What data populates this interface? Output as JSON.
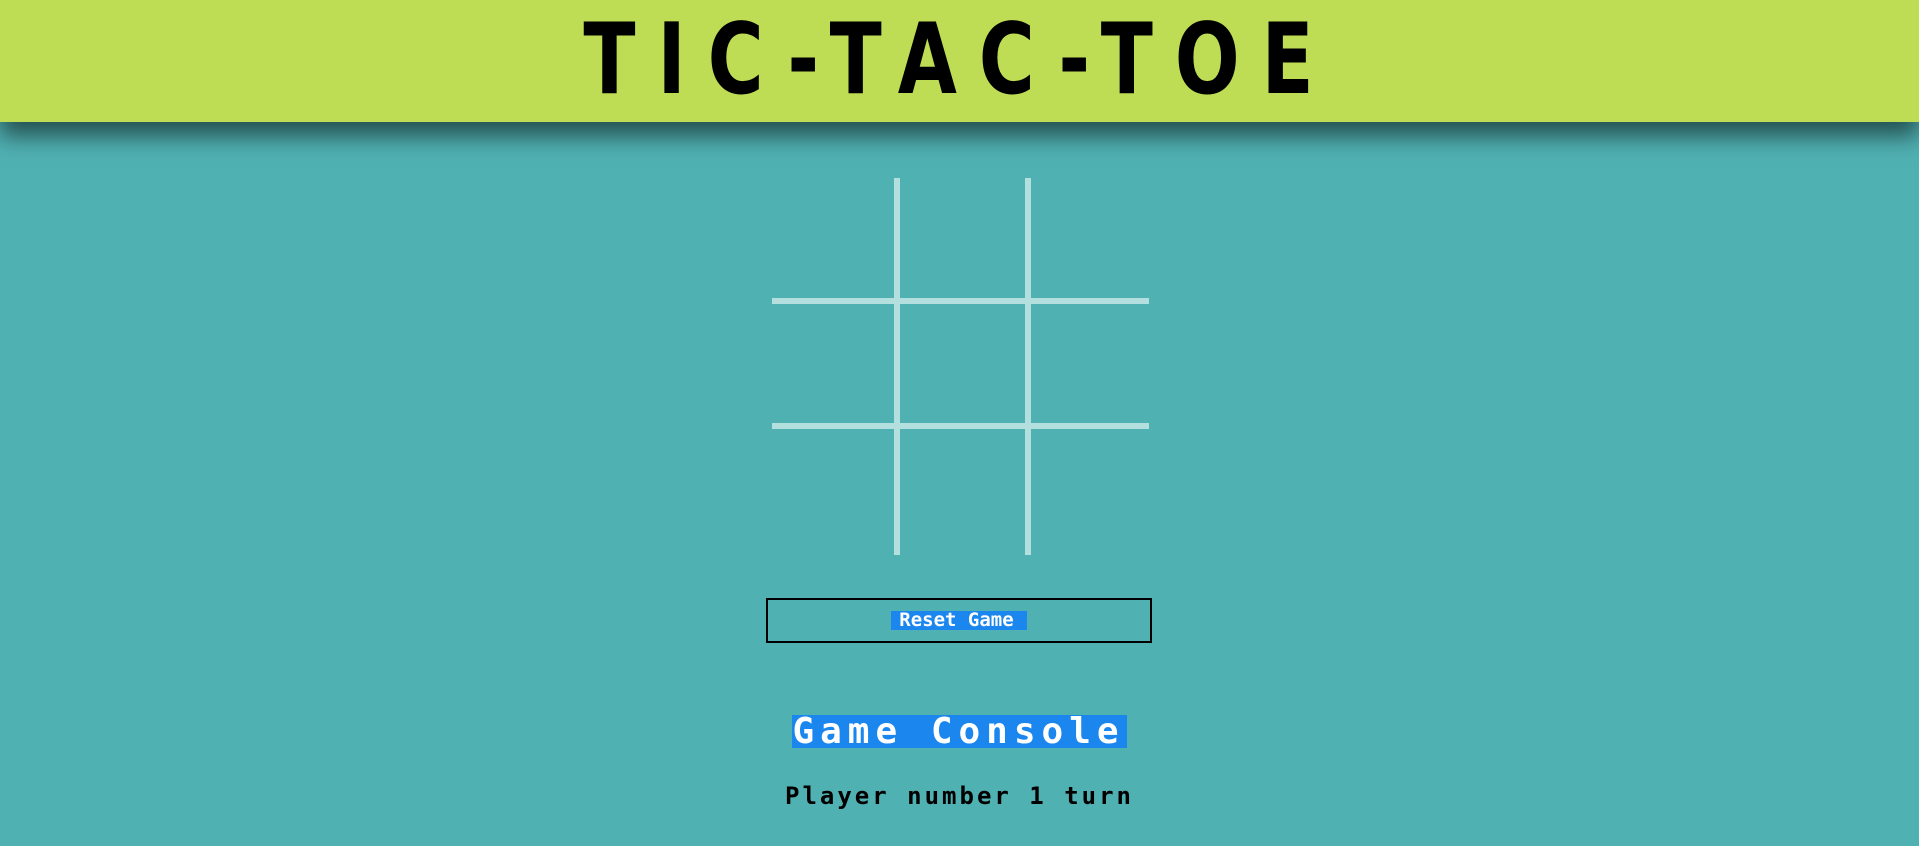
{
  "header": {
    "title": "TIC-TAC-TOE"
  },
  "board": {
    "cells": [
      "",
      "",
      "",
      "",
      "",
      "",
      "",
      "",
      ""
    ]
  },
  "controls": {
    "reset_label": "Reset Game"
  },
  "console": {
    "title": "Game Console",
    "message": "Player number 1 turn"
  },
  "colors": {
    "header_bg": "#bedd55",
    "page_bg": "#50b1b3",
    "grid_line": "#b3e0de",
    "highlight": "#1a86ee"
  }
}
